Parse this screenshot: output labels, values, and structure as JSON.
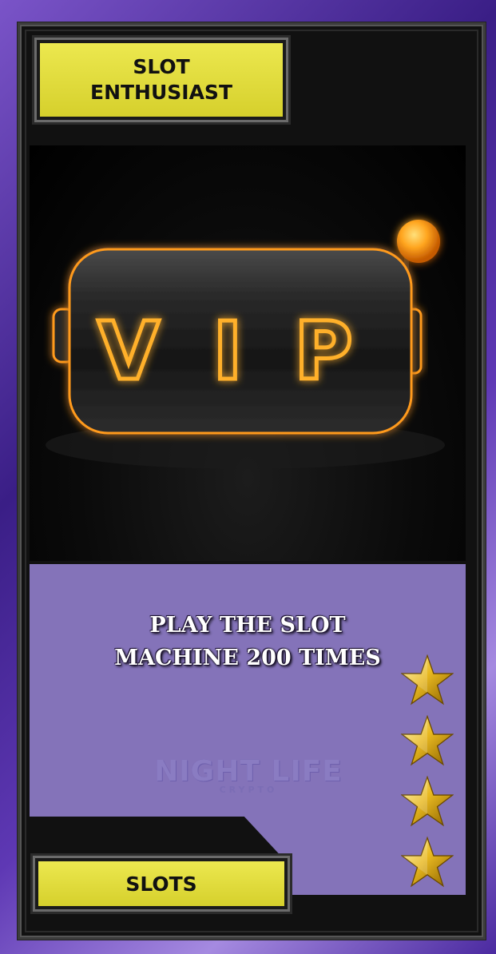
{
  "card": {
    "title_line1": "SLOT",
    "title_line2": "ENTHUSIAST",
    "category": "SLOTS",
    "challenge_line1": "PLAY THE SLOT",
    "challenge_line2": "MACHINE 200 TIMES",
    "artwork_icon": "vip-slot-machine-icon",
    "reel_letters": [
      "V",
      "I",
      "P"
    ],
    "watermark_main": "NIGHT LIFE",
    "watermark_sub": "CRYPTO",
    "star_rating": 4,
    "star_icon": "star-icon"
  },
  "colors": {
    "plaque": "#e2dc3a",
    "panel": "#8473b9",
    "frame": "#5a36b0",
    "neon": "#ff9a1f"
  }
}
